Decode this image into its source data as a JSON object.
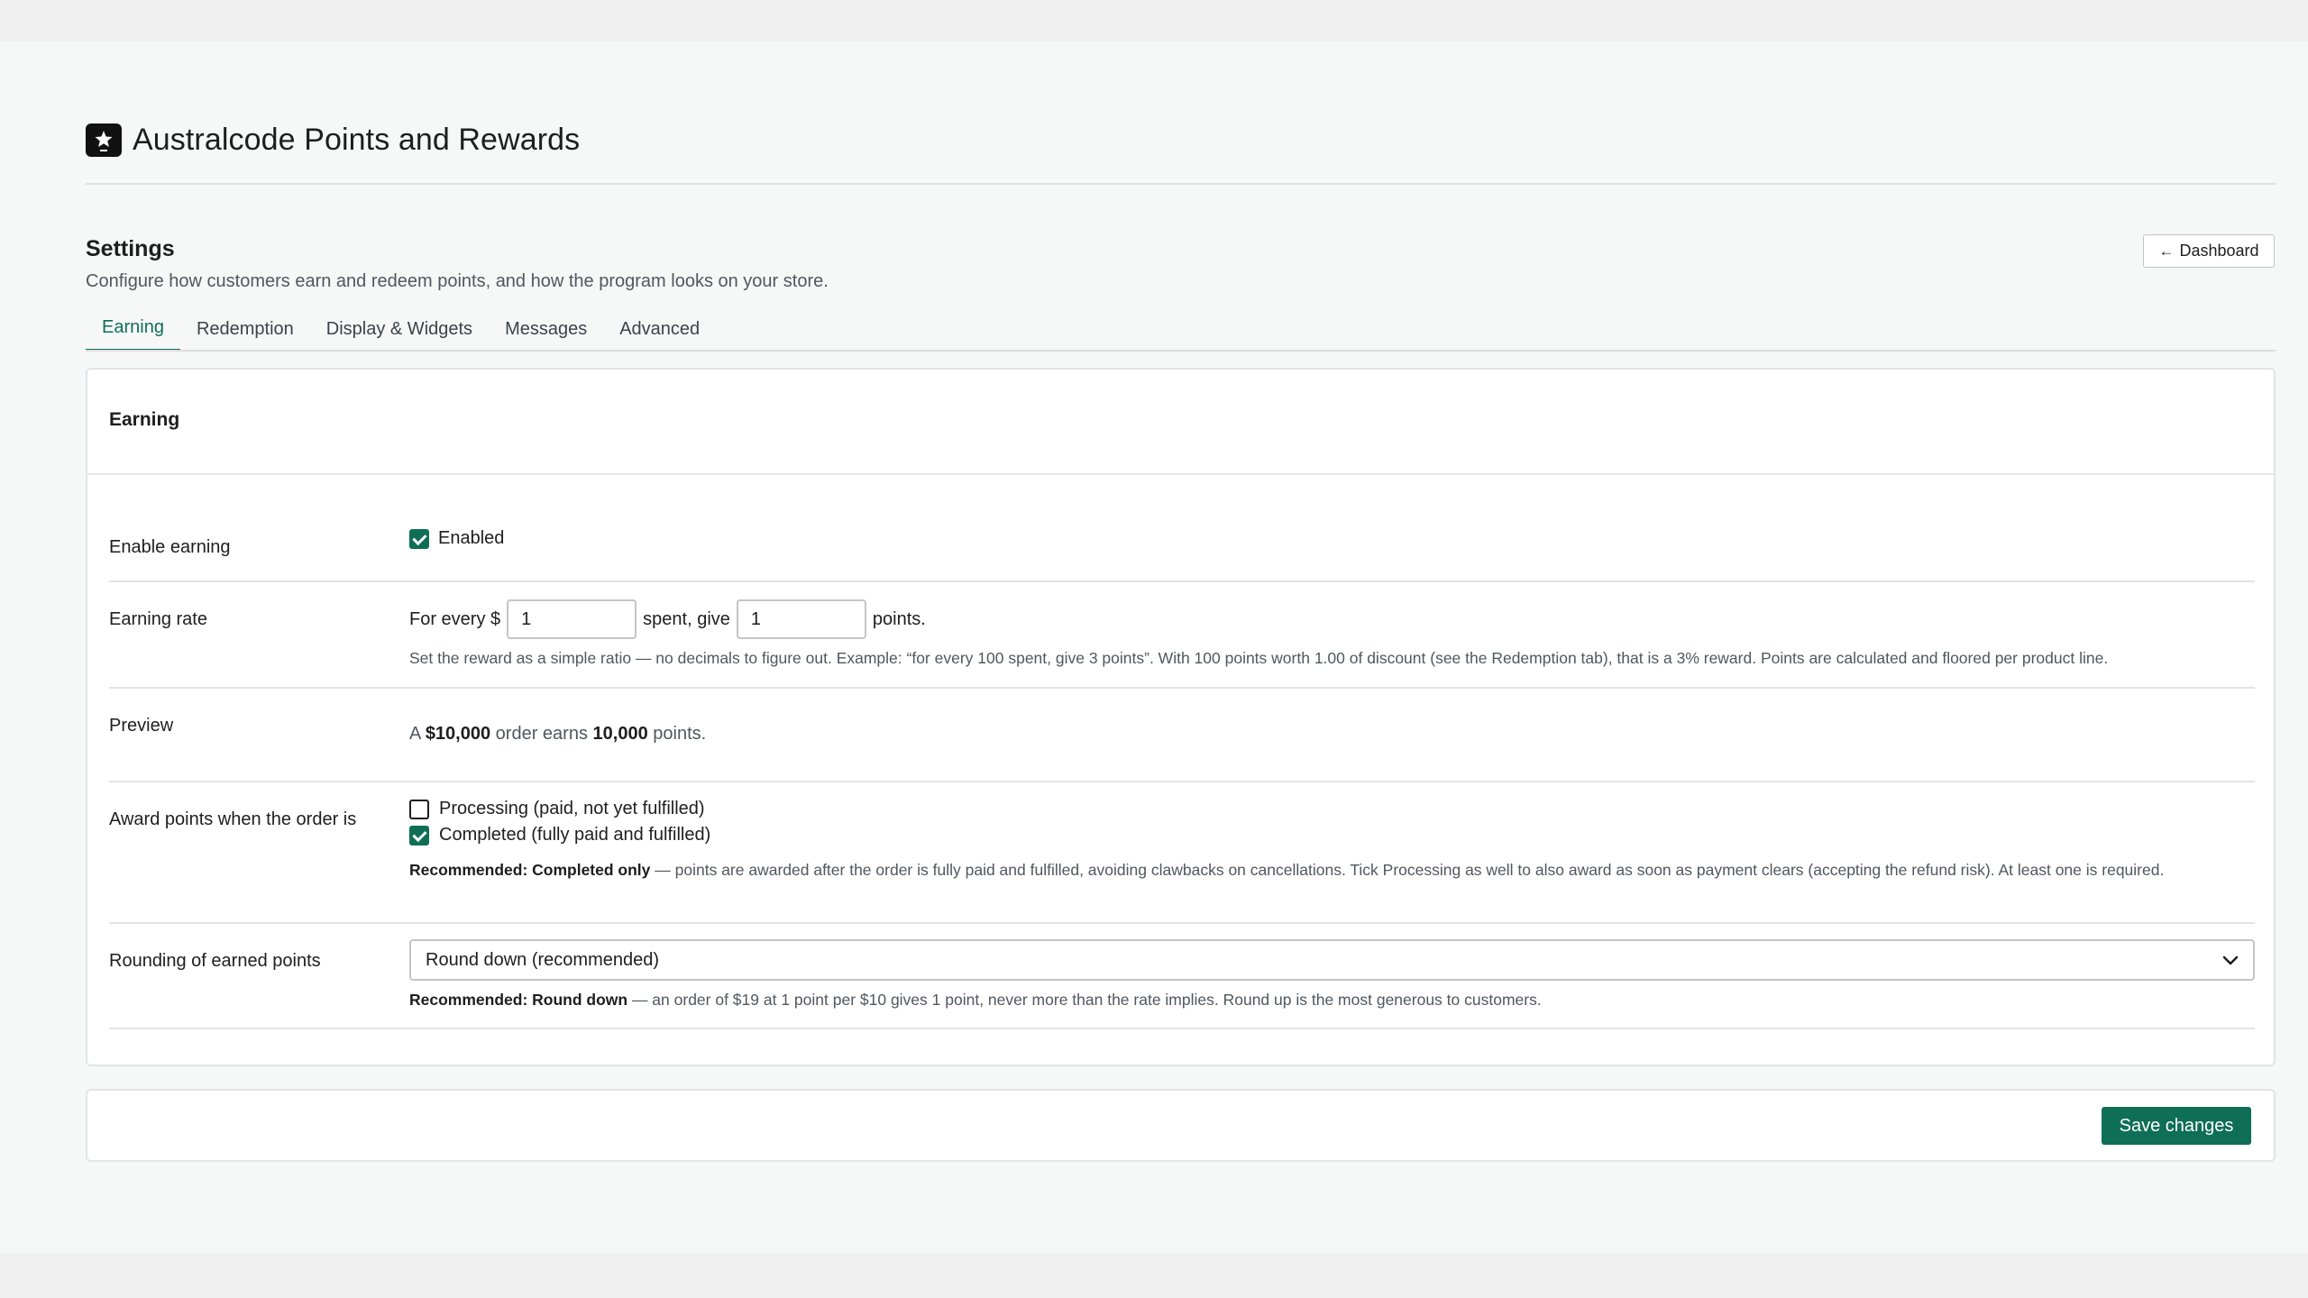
{
  "app": {
    "title": "Australcode Points and Rewards",
    "logo_icon": "star-badge-icon"
  },
  "settings": {
    "title": "Settings",
    "description": "Configure how customers earn and redeem points, and how the program looks on your store.",
    "dashboard_button": "Dashboard",
    "dashboard_arrow": "←"
  },
  "tabs": [
    {
      "label": "Earning",
      "active": true
    },
    {
      "label": "Redemption",
      "active": false
    },
    {
      "label": "Display & Widgets",
      "active": false
    },
    {
      "label": "Messages",
      "active": false
    },
    {
      "label": "Advanced",
      "active": false
    }
  ],
  "card": {
    "title": "Earning",
    "enable": {
      "label": "Enable earning",
      "checkbox_label": "Enabled",
      "checked": true
    },
    "rate": {
      "label": "Earning rate",
      "prefix": "For every $",
      "spend_value": "1",
      "middle": "spent, give",
      "points_value": "1",
      "suffix": "points.",
      "help": "Set the reward as a simple ratio — no decimals to figure out. Example: “for every 100 spent, give 3 points”. With 100 points worth 1.00 of discount (see the Redemption tab), that is a 3% reward. Points are calculated and floored per product line."
    },
    "preview": {
      "label": "Preview",
      "pre": "A",
      "amount": "$10,000",
      "mid": "order earns",
      "points": "10,000",
      "post": "points."
    },
    "award": {
      "label": "Award points when the order is",
      "options": [
        {
          "label": "Processing (paid, not yet fulfilled)",
          "checked": false
        },
        {
          "label": "Completed (fully paid and fulfilled)",
          "checked": true
        }
      ],
      "help_bold": "Recommended: Completed only",
      "help": " — points are awarded after the order is fully paid and fulfilled, avoiding clawbacks on cancellations. Tick Processing as well to also award as soon as payment clears (accepting the refund risk). At least one is required."
    },
    "rounding": {
      "label": "Rounding of earned points",
      "selected": "Round down (recommended)",
      "help_bold": "Recommended: Round down",
      "help": " — an order of $19 at 1 point per $10 gives 1 point, never more than the rate implies. Round up is the most generous to customers."
    }
  },
  "save_button": "Save changes",
  "colors": {
    "accent": "#0f6e56",
    "background": "#f6f7f7",
    "text": "#1e1e1e",
    "muted": "#50575e"
  }
}
